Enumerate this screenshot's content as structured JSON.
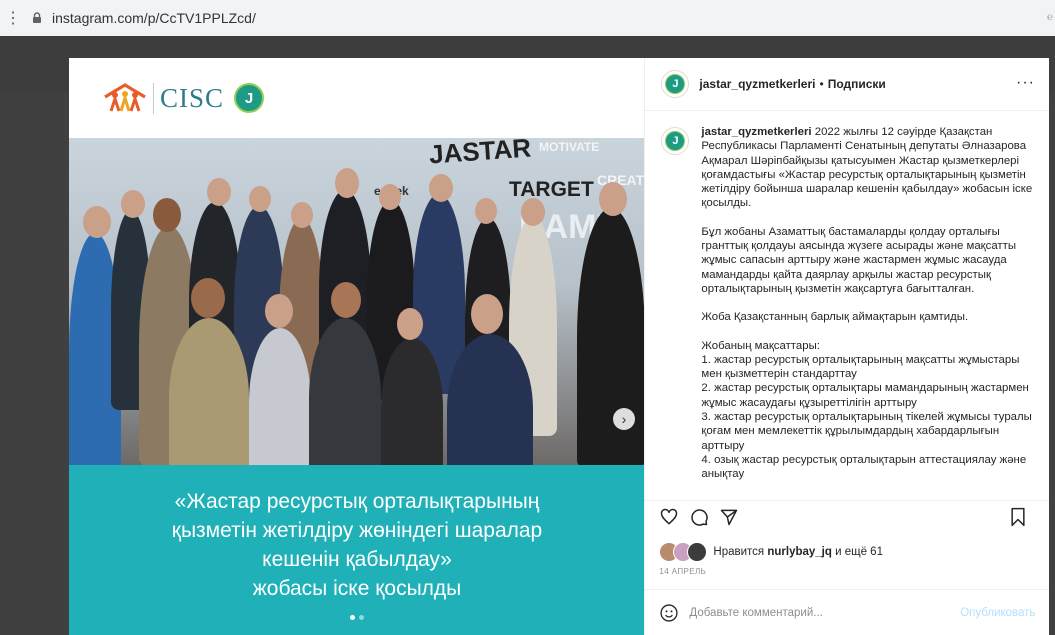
{
  "browser": {
    "url": "instagram.com/p/CcTV1PPLZcd/"
  },
  "post": {
    "username": "jastar_qyzmetkerleri",
    "follow_label": "Подписки",
    "caption_paragraphs": [
      "2022 жылғы 12 сәуірде Қазақстан Республикасы Парламенті Сенатының депутаты Әлназарова Ақмарал Шәріпбайқызы қатысуымен Жастар қызметкерлері қоғамдастығы «Жастар ресурстық орталықтарының қызметін жетілдіру бойынша шаралар кешенін қабылдау» жобасын іске қосылды.",
      "Бұл жобаны Азаматтық бастамаларды қолдау орталығы гранттық қолдауы аясында жүзеге асырады және мақсатты жұмыс сапасын арттыру және жастармен жұмыс жасауда мамандарды қайта даярлау арқылы жастар ресурстық орталықтарының қызметін жақсартуға бағытталған.",
      "Жоба Қазақстанның барлық аймақтарын қамтиды.",
      "Жобаның мақсаттары:\n1. жастар ресурстық орталықтарының мақсатты жұмыстары мен қызметтерін стандарттау\n2. жастар ресурстық орталықтары мамандарының жастармен жұмыс жасаудағы құзыреттілігін арттыру\n3. жастар ресурстық орталықтарының тікелей жұмысы туралы қоғам мен мемлекеттік құрылымдардың хабардарлығын арттыру\n4. озық жастар ресурстық орталықтарын аттестациялау және анықтау"
    ],
    "likes_prefix": "Нравится ",
    "likes_user": "nurlybay_jq",
    "likes_suffix": " и ещё 61",
    "date": "14 АПРЕЛЬ",
    "comment_placeholder": "Добавьте комментарий...",
    "publish_label": "Опубликовать"
  },
  "media": {
    "logo_text": "CISC",
    "wall_words": [
      "JASTAR",
      "MOTIVATE",
      "TARGET",
      "eŋbek",
      "CREATI",
      "DAMU"
    ],
    "slide_caption": [
      "«Жастар ресурстық орталықтарының",
      "қызметін жетілдіру жөніндегі шаралар",
      "кешенін қабылдау»",
      "жобасы іске қосылды"
    ],
    "slide_count": 2,
    "active_slide": 1
  },
  "icons": {
    "lock": "lock-icon",
    "like": "heart-icon",
    "comment": "comment-icon",
    "share": "send-icon",
    "save": "bookmark-icon",
    "emoji": "emoji-icon",
    "more": "more-icon",
    "next": "chevron-right-icon"
  },
  "colors": {
    "caption_bg": "#20b1b8",
    "publish": "#b2dffc",
    "brand": "#2f7d8c"
  }
}
